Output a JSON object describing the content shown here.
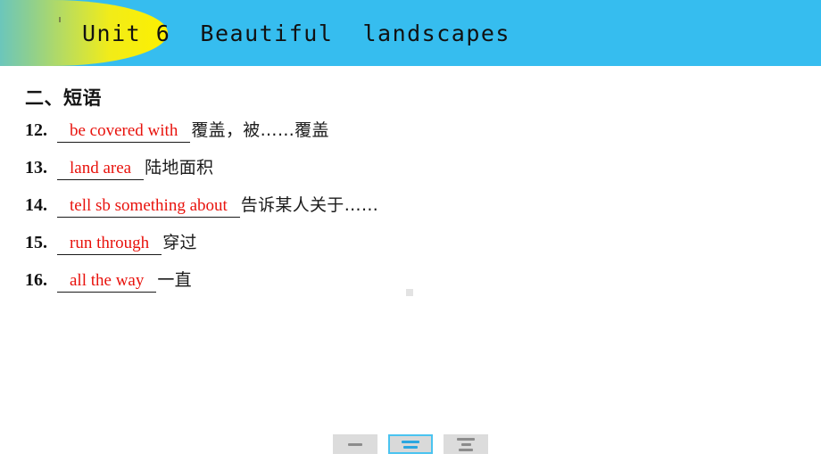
{
  "header": {
    "unit_label": "Unit 6",
    "title": "Beautiful  landscapes",
    "full_title": "Unit 6  Beautiful  landscapes",
    "bg_color": "#36bdef",
    "blob_color": "#fdf000"
  },
  "content": {
    "section_heading": "二、短语",
    "answer_color": "#e8120c",
    "phrases": [
      {
        "number": "12.",
        "answer": "be covered with",
        "meaning": "覆盖，被……覆盖"
      },
      {
        "number": "13.",
        "answer": "land area",
        "meaning": "陆地面积"
      },
      {
        "number": "14.",
        "answer": "tell sb something about",
        "meaning": "告诉某人关于……"
      },
      {
        "number": "15.",
        "answer": "run through",
        "meaning": "穿过"
      },
      {
        "number": "16.",
        "answer": "all the way",
        "meaning": "一直"
      }
    ]
  },
  "toolbar": {
    "buttons": [
      {
        "name": "view-one-line",
        "lines": 1,
        "active": false
      },
      {
        "name": "view-two-lines",
        "lines": 2,
        "active": true
      },
      {
        "name": "view-three-lines",
        "lines": 3,
        "active": false
      }
    ],
    "active_color": "#4ac3f0"
  }
}
